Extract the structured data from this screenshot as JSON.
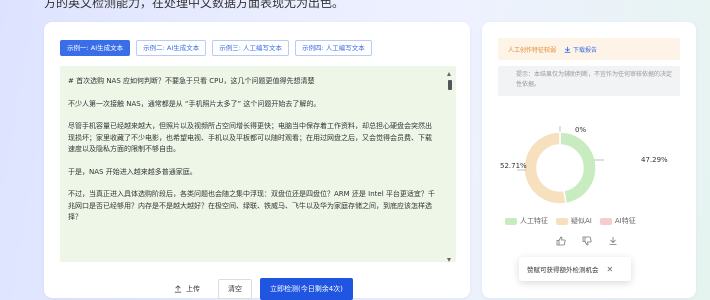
{
  "header": {
    "intro_text": "方的英文检测能力，在处理中文数据方面表现尤为出色。"
  },
  "tabs": [
    {
      "label": "示例一: AI生成文本",
      "active": true
    },
    {
      "label": "示例二: AI生成文本",
      "active": false
    },
    {
      "label": "示例三: 人工编写文本",
      "active": false
    },
    {
      "label": "示例四: 人工编写文本",
      "active": false
    }
  ],
  "editor": {
    "paragraphs": [
      "# 首次选购 NAS 应如何判断？不要急于只看 CPU，这几个问题更值得先想清楚",
      "不少人第一次接触 NAS，通常都是从 “手机照片太多了” 这个问题开始去了解的。",
      "尽管手机容量已经越来越大，但照片以及视频所占空间增长得更快；电脑当中保存着工作资料，却总担心硬盘会突然出现损坏；家里收藏了不少电影，也希望电视、手机以及平板都可以随时观看；在用过网盘之后，又会觉得会员费、下载速度以及隐私方面的限制不够自由。",
      "于是，NAS 开始进入越来越多普通家庭。",
      "不过，当真正进入具体选购阶段后，各类问题也会随之集中浮现：双盘位还是四盘位？ARM 还是 Intel 平台更适宜？千兆网口是否已经够用？内存是不是越大越好？在极空间、绿联、铁威马、飞牛以及华为家庭存储之间，到底应该怎样选择？"
    ]
  },
  "actions": {
    "upload_label": "上传",
    "clear_label": "清空",
    "detect_label": "立即检测(今日剩余4次)"
  },
  "report": {
    "title": "人工创作特征较弱",
    "download_label": "下载报告",
    "note": "提示：本结果仅为辅助判断，不宜作为任何审核依据的决定性依据。"
  },
  "chart_data": {
    "type": "pie",
    "donut": true,
    "series": [
      {
        "name": "人工特征",
        "value": 47.29,
        "label": "47.29%",
        "color": "#c8ecc0"
      },
      {
        "name": "疑似AI",
        "value": 52.71,
        "label": "52.71%",
        "color": "#f7e0be"
      },
      {
        "name": "AI特征",
        "value": 0,
        "label": "0%",
        "color": "#f6cccc"
      }
    ]
  },
  "toast": {
    "text": "赞赋可获得额外检测机会"
  },
  "icons": {
    "upload": "upload-icon",
    "download": "download-icon",
    "like": "thumbs-up-icon",
    "dislike": "thumbs-down-icon",
    "copy": "copy-icon",
    "close": "close-icon"
  }
}
